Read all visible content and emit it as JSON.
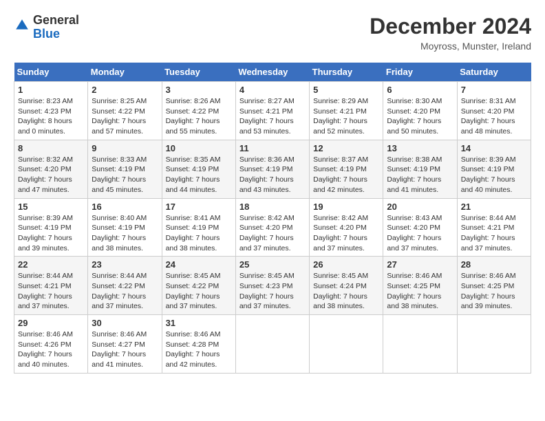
{
  "header": {
    "logo_general": "General",
    "logo_blue": "Blue",
    "month": "December 2024",
    "location": "Moyross, Munster, Ireland"
  },
  "weekdays": [
    "Sunday",
    "Monday",
    "Tuesday",
    "Wednesday",
    "Thursday",
    "Friday",
    "Saturday"
  ],
  "weeks": [
    [
      {
        "day": "1",
        "sunrise": "8:23 AM",
        "sunset": "4:23 PM",
        "daylight": "8 hours and 0 minutes."
      },
      {
        "day": "2",
        "sunrise": "8:25 AM",
        "sunset": "4:22 PM",
        "daylight": "7 hours and 57 minutes."
      },
      {
        "day": "3",
        "sunrise": "8:26 AM",
        "sunset": "4:22 PM",
        "daylight": "7 hours and 55 minutes."
      },
      {
        "day": "4",
        "sunrise": "8:27 AM",
        "sunset": "4:21 PM",
        "daylight": "7 hours and 53 minutes."
      },
      {
        "day": "5",
        "sunrise": "8:29 AM",
        "sunset": "4:21 PM",
        "daylight": "7 hours and 52 minutes."
      },
      {
        "day": "6",
        "sunrise": "8:30 AM",
        "sunset": "4:20 PM",
        "daylight": "7 hours and 50 minutes."
      },
      {
        "day": "7",
        "sunrise": "8:31 AM",
        "sunset": "4:20 PM",
        "daylight": "7 hours and 48 minutes."
      }
    ],
    [
      {
        "day": "8",
        "sunrise": "8:32 AM",
        "sunset": "4:20 PM",
        "daylight": "7 hours and 47 minutes."
      },
      {
        "day": "9",
        "sunrise": "8:33 AM",
        "sunset": "4:19 PM",
        "daylight": "7 hours and 45 minutes."
      },
      {
        "day": "10",
        "sunrise": "8:35 AM",
        "sunset": "4:19 PM",
        "daylight": "7 hours and 44 minutes."
      },
      {
        "day": "11",
        "sunrise": "8:36 AM",
        "sunset": "4:19 PM",
        "daylight": "7 hours and 43 minutes."
      },
      {
        "day": "12",
        "sunrise": "8:37 AM",
        "sunset": "4:19 PM",
        "daylight": "7 hours and 42 minutes."
      },
      {
        "day": "13",
        "sunrise": "8:38 AM",
        "sunset": "4:19 PM",
        "daylight": "7 hours and 41 minutes."
      },
      {
        "day": "14",
        "sunrise": "8:39 AM",
        "sunset": "4:19 PM",
        "daylight": "7 hours and 40 minutes."
      }
    ],
    [
      {
        "day": "15",
        "sunrise": "8:39 AM",
        "sunset": "4:19 PM",
        "daylight": "7 hours and 39 minutes."
      },
      {
        "day": "16",
        "sunrise": "8:40 AM",
        "sunset": "4:19 PM",
        "daylight": "7 hours and 38 minutes."
      },
      {
        "day": "17",
        "sunrise": "8:41 AM",
        "sunset": "4:19 PM",
        "daylight": "7 hours and 38 minutes."
      },
      {
        "day": "18",
        "sunrise": "8:42 AM",
        "sunset": "4:20 PM",
        "daylight": "7 hours and 37 minutes."
      },
      {
        "day": "19",
        "sunrise": "8:42 AM",
        "sunset": "4:20 PM",
        "daylight": "7 hours and 37 minutes."
      },
      {
        "day": "20",
        "sunrise": "8:43 AM",
        "sunset": "4:20 PM",
        "daylight": "7 hours and 37 minutes."
      },
      {
        "day": "21",
        "sunrise": "8:44 AM",
        "sunset": "4:21 PM",
        "daylight": "7 hours and 37 minutes."
      }
    ],
    [
      {
        "day": "22",
        "sunrise": "8:44 AM",
        "sunset": "4:21 PM",
        "daylight": "7 hours and 37 minutes."
      },
      {
        "day": "23",
        "sunrise": "8:44 AM",
        "sunset": "4:22 PM",
        "daylight": "7 hours and 37 minutes."
      },
      {
        "day": "24",
        "sunrise": "8:45 AM",
        "sunset": "4:22 PM",
        "daylight": "7 hours and 37 minutes."
      },
      {
        "day": "25",
        "sunrise": "8:45 AM",
        "sunset": "4:23 PM",
        "daylight": "7 hours and 37 minutes."
      },
      {
        "day": "26",
        "sunrise": "8:45 AM",
        "sunset": "4:24 PM",
        "daylight": "7 hours and 38 minutes."
      },
      {
        "day": "27",
        "sunrise": "8:46 AM",
        "sunset": "4:25 PM",
        "daylight": "7 hours and 38 minutes."
      },
      {
        "day": "28",
        "sunrise": "8:46 AM",
        "sunset": "4:25 PM",
        "daylight": "7 hours and 39 minutes."
      }
    ],
    [
      {
        "day": "29",
        "sunrise": "8:46 AM",
        "sunset": "4:26 PM",
        "daylight": "7 hours and 40 minutes."
      },
      {
        "day": "30",
        "sunrise": "8:46 AM",
        "sunset": "4:27 PM",
        "daylight": "7 hours and 41 minutes."
      },
      {
        "day": "31",
        "sunrise": "8:46 AM",
        "sunset": "4:28 PM",
        "daylight": "7 hours and 42 minutes."
      },
      null,
      null,
      null,
      null
    ]
  ]
}
